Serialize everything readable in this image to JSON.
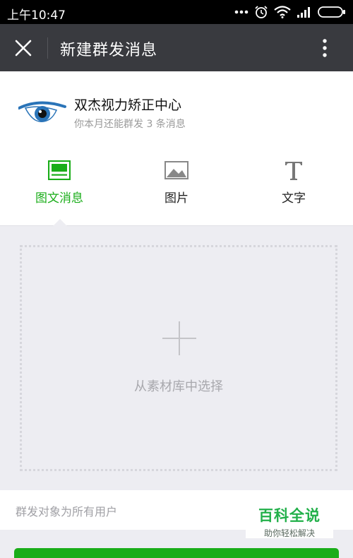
{
  "status_bar": {
    "time": "上午10:47",
    "icons": [
      "more-dots-icon",
      "alarm-icon",
      "wifi-icon",
      "signal-icon",
      "battery-icon"
    ]
  },
  "title_bar": {
    "title": "新建群发消息",
    "close_icon": "close-icon",
    "more_icon": "more-vertical-icon"
  },
  "account": {
    "name": "双杰视力矫正中心",
    "quota": "你本月还能群发 3 条消息",
    "logo_icon": "eye-logo-icon"
  },
  "tabs": [
    {
      "label": "图文消息",
      "icon": "article-icon",
      "active": true
    },
    {
      "label": "图片",
      "icon": "image-icon",
      "active": false
    },
    {
      "label": "文字",
      "icon": "text-icon",
      "active": false
    }
  ],
  "upload": {
    "label": "从素材库中选择",
    "icon": "plus-icon"
  },
  "recipients": {
    "text": "群发对象为所有用户"
  },
  "watermark": {
    "title": "百科全说",
    "subtitle": "助你轻松解决"
  },
  "colors": {
    "accent": "#1aad19",
    "title_bar": "#393a3f",
    "background": "#ededf2"
  }
}
